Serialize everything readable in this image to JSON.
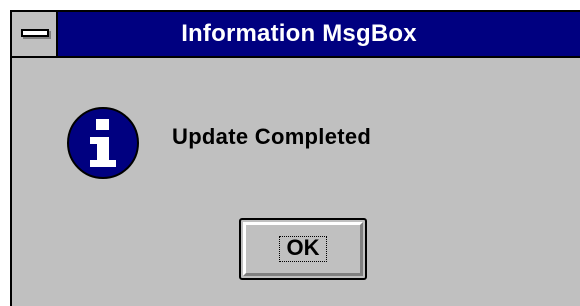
{
  "window": {
    "title": "Information MsgBox",
    "title_bar_color": "#000080",
    "background_color": "#c0c0c0"
  },
  "title_bar": {
    "system_menu_icon": "system-menu-icon"
  },
  "content": {
    "icon": "information-icon",
    "icon_color": "#000080",
    "message": "Update Completed"
  },
  "buttons": {
    "ok_label": "OK"
  }
}
